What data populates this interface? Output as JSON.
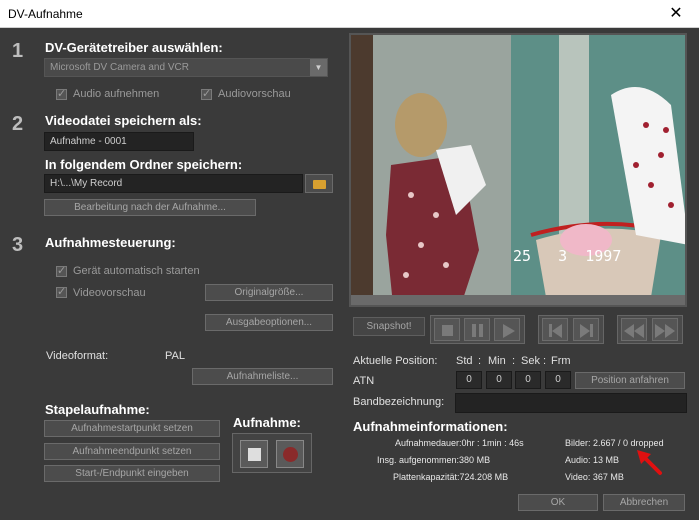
{
  "window": {
    "title": "DV-Aufnahme",
    "close_glyph": "✕"
  },
  "step1": {
    "number": "1",
    "heading": "DV-Gerätetreiber auswählen:",
    "driver_value": "Microsoft DV Camera and VCR",
    "audio_record_label": "Audio aufnehmen",
    "audio_preview_label": "Audiovorschau"
  },
  "step2": {
    "number": "2",
    "heading": "Videodatei speichern als:",
    "filename_value": "Aufnahme - 0001",
    "folder_heading": "In folgendem Ordner speichern:",
    "folder_value": "H:\\...\\My Record",
    "post_edit_button": "Bearbeitung nach der Aufnahme..."
  },
  "step3": {
    "number": "3",
    "heading": "Aufnahmesteuerung:",
    "auto_start_label": "Gerät automatisch starten",
    "video_preview_label": "Videovorschau",
    "original_size_button": "Originalgröße...",
    "output_options_button": "Ausgabeoptionen...",
    "video_format_label": "Videoformat:",
    "video_format_value": "PAL",
    "capture_list_button": "Aufnahmeliste..."
  },
  "batch": {
    "heading": "Stapelaufnahme:",
    "set_start_button": "Aufnahmestartpunkt setzen",
    "set_end_button": "Aufnahmeendpunkt setzen",
    "enter_points_button": "Start-/Endpunkt eingeben"
  },
  "recording": {
    "heading": "Aufnahme:"
  },
  "preview": {
    "date_overlay": "25   3  1997",
    "snapshot_button": "Snapshot!"
  },
  "position": {
    "label": "Aktuelle Position:",
    "units": [
      "Std",
      "Min",
      "Sek",
      "Frm"
    ],
    "atn_label": "ATN",
    "values": [
      "0",
      "0",
      "0",
      "0"
    ],
    "goto_button": "Position anfahren",
    "tape_label": "Bandbezeichnung:",
    "tape_value": ""
  },
  "capture_info": {
    "heading": "Aufnahmeinformationen:",
    "duration": "Aufnahmedauer:0hr : 1min : 46s",
    "total_recorded": "Insg. aufgenommen:380 MB",
    "disk_capacity": "Plattenkapazität:724.208 MB",
    "frames": "Bilder: 2.667 / 0 dropped",
    "audio": "Audio: 13 MB",
    "video": "Video: 367 MB"
  },
  "footer": {
    "ok_button": "OK",
    "cancel_button": "Abbrechen"
  },
  "colors": {
    "background": "#3a3a3a",
    "record_red": "#8a2a2a",
    "annotation_arrow": "#e01010"
  }
}
